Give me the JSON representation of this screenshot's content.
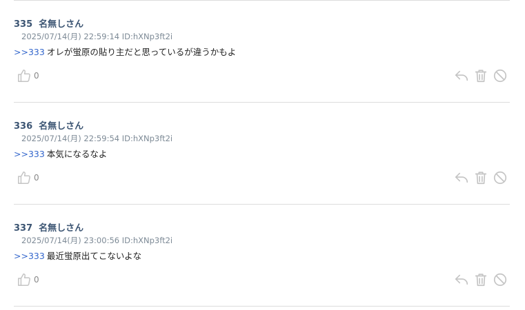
{
  "posts": [
    {
      "number": "335",
      "name": "名無しさん",
      "date": "2025/07/14(月)",
      "time": "22:59:14",
      "id": "ID:hXNp3ft2i",
      "anchor": ">>333",
      "text": "オレが蛍原の貼り主だと思っているが違うかもよ",
      "likes": "0"
    },
    {
      "number": "336",
      "name": "名無しさん",
      "date": "2025/07/14(月)",
      "time": "22:59:54",
      "id": "ID:hXNp3ft2i",
      "anchor": ">>333",
      "text": "本気になるなよ",
      "likes": "0"
    },
    {
      "number": "337",
      "name": "名無しさん",
      "date": "2025/07/14(月)",
      "time": "23:00:56",
      "id": "ID:hXNp3ft2i",
      "anchor": ">>333",
      "text": "最近蛍原出てこないよな",
      "likes": "0"
    }
  ],
  "icons": {
    "like": "thumbs-up-icon",
    "reply": "reply-icon",
    "delete": "trash-icon",
    "report": "block-icon"
  },
  "colors": {
    "name": "#3c5573",
    "meta": "#7d8a96",
    "anchor": "#3366cc",
    "icon": "#c4c4c4",
    "divider": "#dcdcdc"
  }
}
